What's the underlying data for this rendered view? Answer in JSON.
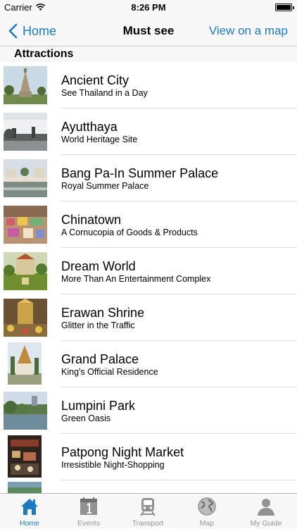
{
  "status_bar": {
    "carrier": "Carrier",
    "time": "8:26 PM"
  },
  "nav": {
    "back_label": "Home",
    "title": "Must see",
    "action_label": "View on a map"
  },
  "section": {
    "title": "Attractions"
  },
  "attractions": [
    {
      "title": "Ancient City",
      "subtitle": "See Thailand in a Day"
    },
    {
      "title": "Ayutthaya",
      "subtitle": "World Heritage Site"
    },
    {
      "title": "Bang Pa-In Summer Palace",
      "subtitle": "Royal Summer Palace"
    },
    {
      "title": "Chinatown",
      "subtitle": "A Cornucopia of Goods & Products"
    },
    {
      "title": "Dream World",
      "subtitle": "More Than An Entertainment Complex"
    },
    {
      "title": "Erawan Shrine",
      "subtitle": "Glitter in the Traffic"
    },
    {
      "title": "Grand Palace",
      "subtitle": "King's Official Residence"
    },
    {
      "title": "Lumpini Park",
      "subtitle": "Green Oasis"
    },
    {
      "title": "Patpong Night Market",
      "subtitle": "Irresistible Night-Shopping"
    }
  ],
  "tabs": [
    {
      "label": "Home",
      "icon": "house-icon",
      "active": true
    },
    {
      "label": "Events",
      "icon": "calendar-icon",
      "active": false
    },
    {
      "label": "Transport",
      "icon": "train-icon",
      "active": false
    },
    {
      "label": "Map",
      "icon": "globe-icon",
      "active": false
    },
    {
      "label": "My Guide",
      "icon": "person-icon",
      "active": false
    }
  ],
  "colors": {
    "accent": "#1a7bc0",
    "inactive_tab": "#929292",
    "bar_background": "#f7f7f7"
  }
}
